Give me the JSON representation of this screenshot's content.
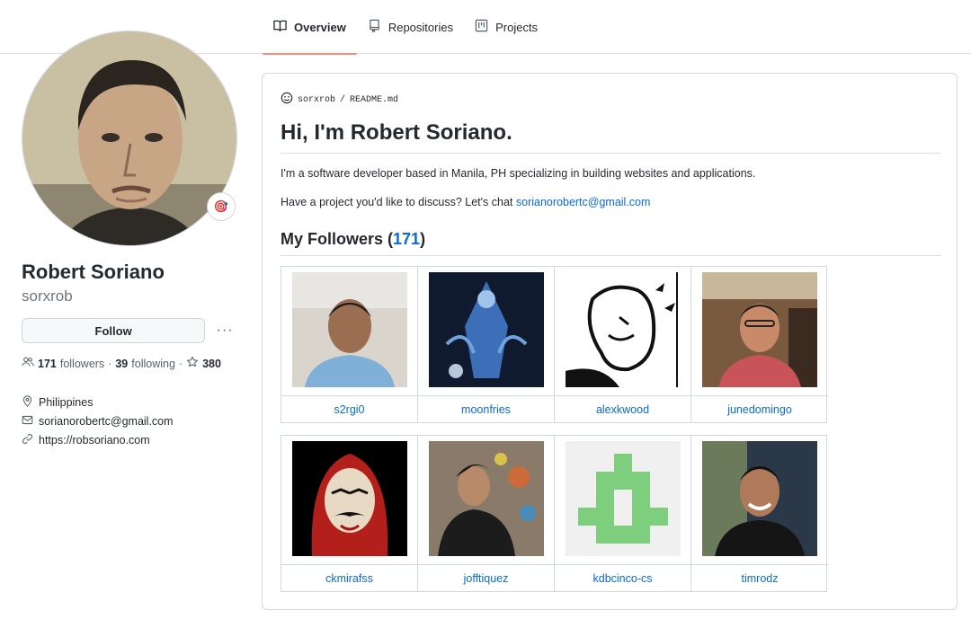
{
  "tabs": [
    {
      "label": "Overview",
      "icon": "book-icon",
      "active": true
    },
    {
      "label": "Repositories",
      "icon": "repo-icon",
      "active": false
    },
    {
      "label": "Projects",
      "icon": "project-icon",
      "active": false
    }
  ],
  "profile": {
    "fullname": "Robert Soriano",
    "username": "sorxrob",
    "status_emoji": "🎯",
    "follow_label": "Follow",
    "more_label": "···",
    "followers_count": "171",
    "followers_label": "followers",
    "following_count": "39",
    "following_label": "following",
    "stars_count": "380",
    "location": "Philippines",
    "email": "sorianorobertc@gmail.com",
    "website": "https://robsoriano.com"
  },
  "readme": {
    "owner": "sorxrob",
    "separator": "/",
    "file": "README.md",
    "heading": "Hi, I'm Robert Soriano.",
    "intro": "I'm a software developer based in Manila, PH specializing in building websites and applications.",
    "chat_prefix": "Have a project you'd like to discuss? Let's chat",
    "chat_email": "sorianorobertc@gmail.com",
    "followers_heading_prefix": "My Followers (",
    "followers_heading_count": "171",
    "followers_heading_suffix": ")",
    "followers": [
      {
        "name": "s2rgi0"
      },
      {
        "name": "moonfries"
      },
      {
        "name": "alexkwood"
      },
      {
        "name": "junedomingo"
      },
      {
        "name": "ckmirafss"
      },
      {
        "name": "jofftiquez"
      },
      {
        "name": "kdbcinco-cs"
      },
      {
        "name": "timrodz"
      }
    ]
  },
  "colors": {
    "link": "#0969da",
    "tab_underline": "#fd8c73",
    "identicon": "#7dcf7d"
  }
}
